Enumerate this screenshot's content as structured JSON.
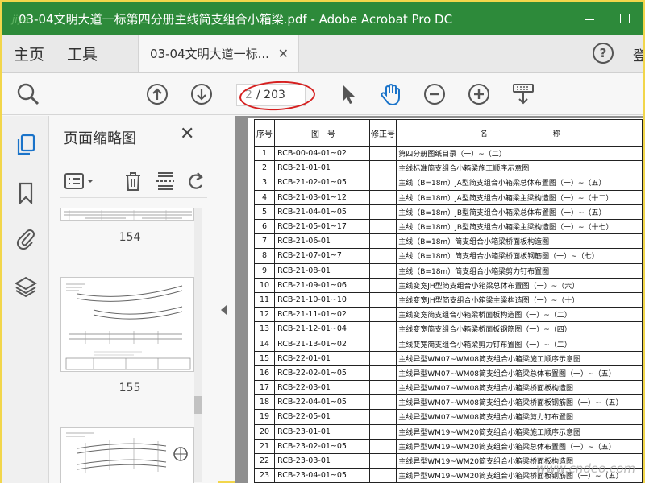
{
  "window": {
    "title": "03-04文明大道一标第四分册主线简支组合小箱梁.pdf - Adobe Acrobat Pro DC"
  },
  "tabs": {
    "home": "主页",
    "tools": "工具",
    "document": "03-04文明大道一标..."
  },
  "toolbar": {
    "current_page": "2",
    "total_pages": "/ 203"
  },
  "thumb_panel": {
    "title": "页面缩略图",
    "pages": [
      "154",
      "155"
    ]
  },
  "table": {
    "headers": {
      "no": "序号",
      "code": "图　号",
      "rev": "修正号",
      "name": "名　　　　　　　　　称"
    },
    "rows": [
      {
        "no": "1",
        "code": "RCB-00-04-01~02",
        "name": "第四分册图纸目录（一）~（二）"
      },
      {
        "no": "2",
        "code": "RCB-21-01-01",
        "name": "主线标准简支组合小箱梁施工顺序示意图"
      },
      {
        "no": "3",
        "code": "RCB-21-02-01~05",
        "name": "主线（B=18m）JA型简支组合小箱梁总体布置图（一）~（五）"
      },
      {
        "no": "4",
        "code": "RCB-21-03-01~12",
        "name": "主线（B=18m）JA型简支组合小箱梁主梁构造图（一）~（十二）"
      },
      {
        "no": "5",
        "code": "RCB-21-04-01~05",
        "name": "主线（B=18m）JB型简支组合小箱梁总体布置图（一）~（五）"
      },
      {
        "no": "6",
        "code": "RCB-21-05-01~17",
        "name": "主线（B=18m）JB型简支组合小箱梁主梁构造图（一）~（十七）"
      },
      {
        "no": "7",
        "code": "RCB-21-06-01",
        "name": "主线（B=18m）简支组合小箱梁桥面板构造图"
      },
      {
        "no": "8",
        "code": "RCB-21-07-01~7",
        "name": "主线（B=18m）简支组合小箱梁桥面板钢筋图（一）~（七）"
      },
      {
        "no": "9",
        "code": "RCB-21-08-01",
        "name": "主线（B=18m）简支组合小箱梁剪力钉布置图"
      },
      {
        "no": "10",
        "code": "RCB-21-09-01~06",
        "name": "主线变宽JH型简支组合小箱梁总体布置图（一）~（六）"
      },
      {
        "no": "11",
        "code": "RCB-21-10-01~10",
        "name": "主线变宽JH型简支组合小箱梁主梁构造图（一）~（十）"
      },
      {
        "no": "12",
        "code": "RCB-21-11-01~02",
        "name": "主线变宽简支组合小箱梁桥面板构造图（一）~（二）"
      },
      {
        "no": "13",
        "code": "RCB-21-12-01~04",
        "name": "主线变宽简支组合小箱梁桥面板钢筋图（一）~（四）"
      },
      {
        "no": "14",
        "code": "RCB-21-13-01~02",
        "name": "主线变宽简支组合小箱梁剪力钉布置图（一）~（二）"
      },
      {
        "no": "15",
        "code": "RCB-22-01-01",
        "name": "主线异型WM07~WM08简支组合小箱梁施工顺序示意图"
      },
      {
        "no": "16",
        "code": "RCB-22-02-01~05",
        "name": "主线异型WM07~WM08简支组合小箱梁总体布置图（一）~（五）"
      },
      {
        "no": "17",
        "code": "RCB-22-03-01",
        "name": "主线异型WM07~WM08简支组合小箱梁桥面板构造图"
      },
      {
        "no": "18",
        "code": "RCB-22-04-01~05",
        "name": "主线异型WM07~WM08简支组合小箱梁桥面板钢筋图（一）~（五）"
      },
      {
        "no": "19",
        "code": "RCB-22-05-01",
        "name": "主线异型WM07~WM08简支组合小箱梁剪力钉布置图"
      },
      {
        "no": "20",
        "code": "RCB-23-01-01",
        "name": "主线异型WM19~WM20简支组合小箱梁施工顺序示意图"
      },
      {
        "no": "21",
        "code": "RCB-23-02-01~05",
        "name": "主线异型WM19~WM20简支组合小箱梁总体布置图（一）~（五）"
      },
      {
        "no": "22",
        "code": "RCB-23-03-01",
        "name": "主线异型WM19~WM20简支组合小箱梁桥面板构造图"
      },
      {
        "no": "23",
        "code": "RCB-23-04-01~05",
        "name": "主线异型WM19~WM20简支组合小箱梁桥面板钢筋图（一）~（五）"
      }
    ]
  },
  "colors": {
    "titlebar": "#2d8a3a",
    "accent_blue": "#1a73c9",
    "annotation": "#d61f1f",
    "frame": "#f2d64b"
  },
  "icons": [
    "search-icon",
    "arrow-up-icon",
    "arrow-down-icon",
    "cursor-icon",
    "hand-icon",
    "zoom-out-icon",
    "zoom-in-icon",
    "scan-icon",
    "pages-icon",
    "bookmark-icon",
    "paperclip-icon",
    "layers-icon",
    "options-icon",
    "trash-icon",
    "extract-icon",
    "rotate-icon",
    "help-icon",
    "close-icon"
  ],
  "watermarks": {
    "top_left": "jiya",
    "bottom_right": "www.cndeo.com"
  }
}
